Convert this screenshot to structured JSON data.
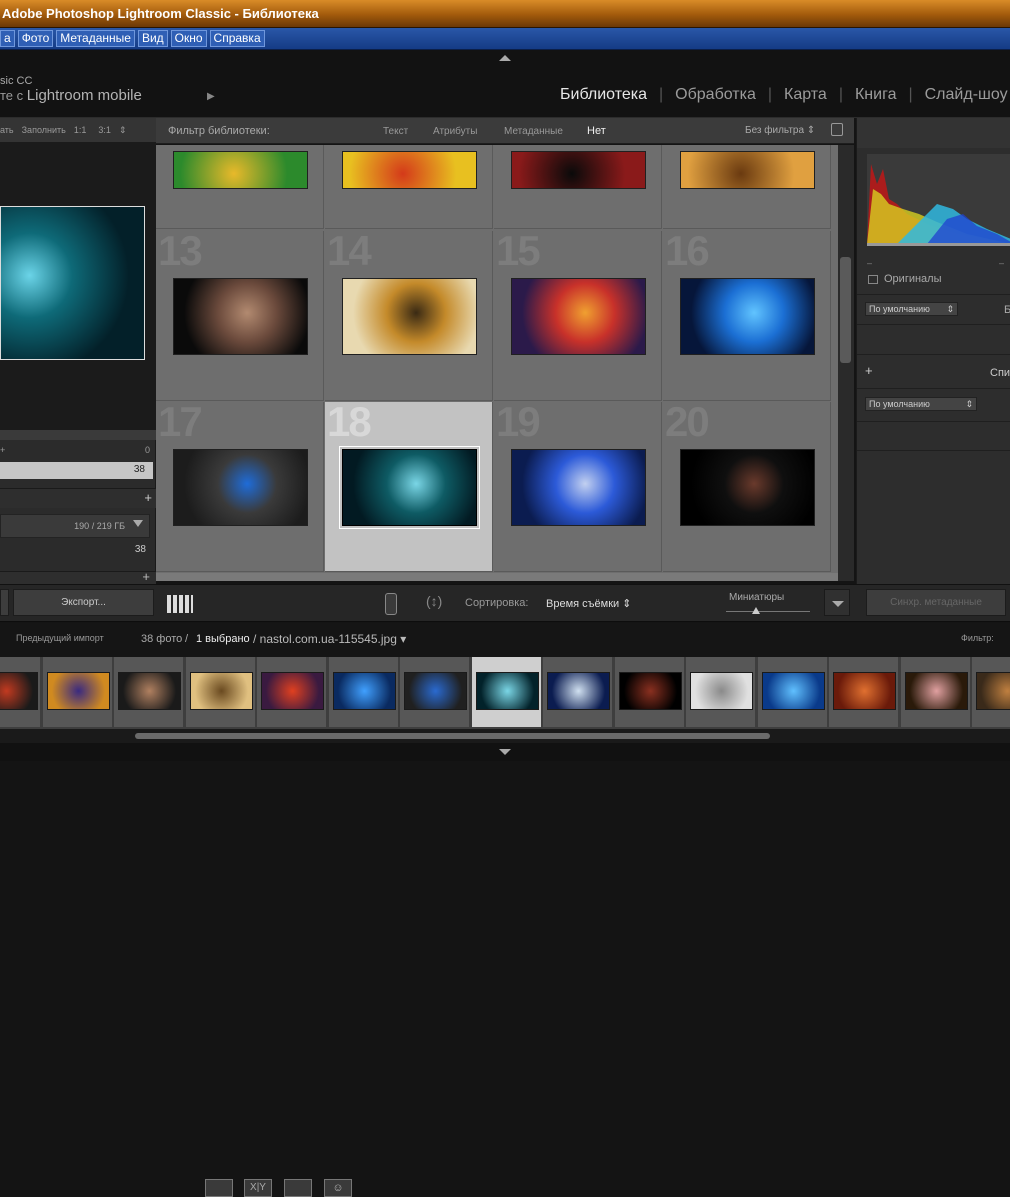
{
  "window": {
    "title": "Adobe Photoshop Lightroom Classic - Библиотека"
  },
  "menu": {
    "items": [
      "а",
      "Фото",
      "Метаданные",
      "Вид",
      "Окно",
      "Справка"
    ]
  },
  "identity": {
    "line1": "sic CC",
    "line2_prefix": "те с ",
    "line2_brand": "Lightroom mobile",
    "play_glyph": "▶"
  },
  "modules": {
    "items": [
      "Библиотека",
      "Обработка",
      "Карта",
      "Книга",
      "Слайд-шоу"
    ],
    "active": "Библиотека",
    "separator": "|"
  },
  "navigator": {
    "labels": [
      "ать",
      "Заполнить",
      "1:1",
      "3:1"
    ],
    "zoom_stepper": "⇕"
  },
  "filter_bar": {
    "label": "Фильтр библиотеки:",
    "tabs": [
      "Текст",
      "Атрибуты",
      "Метаданные",
      "Нет"
    ],
    "active_tab": "Нет",
    "preset": "Без фильтра ⇕"
  },
  "left_panel": {
    "count_zero": "0",
    "count_total": "38",
    "plus1": "+",
    "disk": "190 / 219 ГБ",
    "count_folder": "38",
    "export_button": "Экспорт..."
  },
  "grid": {
    "cells": [
      {
        "num": "13",
        "selected": false,
        "colors": [
          "#0a0a0a",
          "#6b4a3c",
          "#b28a70"
        ]
      },
      {
        "num": "14",
        "selected": false,
        "colors": [
          "#e8d9b0",
          "#c48a2a",
          "#3a2a14"
        ]
      },
      {
        "num": "15",
        "selected": false,
        "colors": [
          "#2b1a4a",
          "#c8312a",
          "#f0a030"
        ]
      },
      {
        "num": "16",
        "selected": false,
        "colors": [
          "#06163a",
          "#1b6fd4",
          "#61c4ff"
        ]
      },
      {
        "num": "17",
        "selected": false,
        "colors": [
          "#1c1c1c",
          "#3a3a3a",
          "#1f6cd8"
        ]
      },
      {
        "num": "18",
        "selected": true,
        "colors": [
          "#021a22",
          "#0e5b64",
          "#7ad6e6"
        ]
      },
      {
        "num": "19",
        "selected": false,
        "colors": [
          "#0b1c50",
          "#2c5ad8",
          "#c2d0f0"
        ]
      },
      {
        "num": "20",
        "selected": false,
        "colors": [
          "#000000",
          "#0f0f0f",
          "#6a3a2c"
        ]
      }
    ],
    "top_row_colors": [
      [
        "#e8b92a",
        "#2c8a2c"
      ],
      [
        "#d43a1a",
        "#e8c020"
      ],
      [
        "#0a0a0a",
        "#8a1a1a"
      ],
      [
        "#6a3a10",
        "#e0a040"
      ]
    ]
  },
  "right_panel": {
    "originals_label": "Оригиналы",
    "default1": "По умолчанию",
    "truncated1": "Б",
    "plus": "+",
    "truncated_title": "Спи",
    "default2": "По умолчанию",
    "sync_button": "Синхр. метаданные"
  },
  "toolbar": {
    "sort_label": "Сортировка:",
    "sort_value": "Время съёмки ⇕",
    "thumbs_label": "Миниатюры"
  },
  "filmstrip_bar": {
    "source": "Предыдущий импорт",
    "count": "38 фото",
    "slash": "/",
    "selected": "1 выбрано",
    "filename": "/ nastol.com.ua-115545.jpg ▾",
    "filter_label": "Фильтр:"
  },
  "filmstrip": {
    "thumbs": [
      [
        "#1a1a1a",
        "#c23a20"
      ],
      [
        "#d08a20",
        "#3a2a80"
      ],
      [
        "#1a1a1a",
        "#b08060"
      ],
      [
        "#e0c080",
        "#6a4a20"
      ],
      [
        "#3a1a40",
        "#e04020"
      ],
      [
        "#0a2a60",
        "#40a0ff"
      ],
      [
        "#202020",
        "#2a6ad0"
      ],
      [
        "#02222a",
        "#7ad6e6"
      ],
      [
        "#0b1c50",
        "#d0e0f0"
      ],
      [
        "#000000",
        "#8a3020"
      ],
      [
        "#e0e0e0",
        "#8a8a8a"
      ],
      [
        "#0a3a8a",
        "#60c0ff"
      ],
      [
        "#6a1a0a",
        "#e07030"
      ],
      [
        "#2a1a0a",
        "#e0a0a0"
      ],
      [
        "#3a2a1a",
        "#c08040"
      ]
    ],
    "selected_index": 7
  },
  "histogram": {
    "colors": [
      "#e02020",
      "#e0e020",
      "#30c0ff",
      "#2040e0",
      "#a0a0a0"
    ]
  }
}
